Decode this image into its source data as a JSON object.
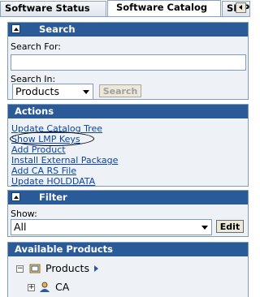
{
  "tabs": [
    {
      "label": "Software Status",
      "active": false
    },
    {
      "label": "Software Catalog",
      "active": true
    },
    {
      "label": "SMP",
      "active": false
    }
  ],
  "tab_scroll_icon": "scroll-left-icon",
  "search": {
    "title": "Search",
    "search_for_label": "Search For:",
    "search_for_value": "",
    "search_in_label": "Search In:",
    "search_in_value": "Products",
    "button_label": "Search",
    "button_disabled": true
  },
  "actions": {
    "title": "Actions",
    "links": [
      {
        "label": "Update Catalog Tree"
      },
      {
        "label": "Show LMP Keys",
        "circled": true
      },
      {
        "label": "Add Product"
      },
      {
        "label": "Install External Package"
      },
      {
        "label": "Add CA RS File"
      },
      {
        "label": "Update HOLDDATA"
      }
    ]
  },
  "filter": {
    "title": "Filter",
    "show_label": "Show:",
    "show_value": "All",
    "edit_label": "Edit"
  },
  "available": {
    "title": "Available Products",
    "tree": [
      {
        "label": "Products",
        "expanded": true,
        "icon": "catalog-folder-icon",
        "has_submenu": true
      },
      {
        "label": "CA",
        "expanded": false,
        "icon": "person-icon"
      }
    ]
  },
  "colors": {
    "panel_header": "#2a5a98",
    "link": "#0c44a8",
    "panel_body": "#eef2f7"
  }
}
